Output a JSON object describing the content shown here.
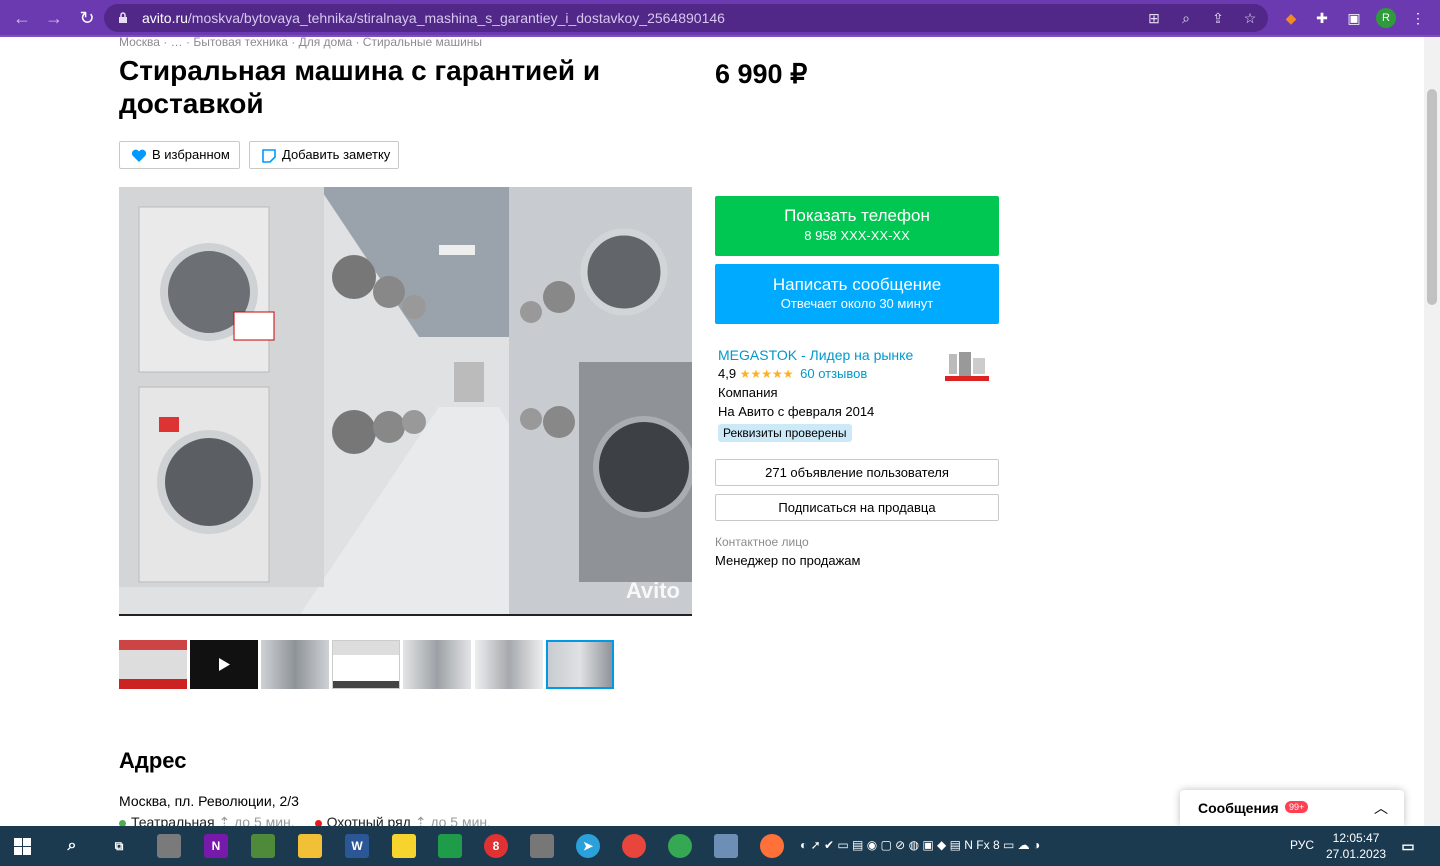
{
  "browser": {
    "url_host": "avito.ru",
    "url_path": "/moskva/bytovaya_tehnika/stiralnaya_mashina_s_garantiey_i_dostavkoy_2564890146",
    "avatar_letter": "R"
  },
  "breadcrumbs": [
    "Москва",
    "…",
    "Бытовая техника",
    "Для дома",
    "Стиральные машины"
  ],
  "listing": {
    "title": "Стиральная машина с гарантией и доставкой",
    "price": "6 990 ₽",
    "favorite_label": "В избранном",
    "note_label": "Добавить заметку",
    "photo_watermark": "Avito",
    "thumbnail_count": 7
  },
  "actions": {
    "phone_title": "Показать телефон",
    "phone_number": "8 958 XXX-XX-XX",
    "message_title": "Написать сообщение",
    "message_sub": "Отвечает около 30 минут"
  },
  "seller": {
    "name": "MEGASTOK - Лидер на рынке",
    "rating": "4,9",
    "stars": "★★★★★",
    "reviews": "60 отзывов",
    "type": "Компания",
    "since": "На Авито с февраля 2014",
    "verified": "Реквизиты проверены",
    "listings_button": "271 объявление пользователя",
    "subscribe_button": "Подписаться на продавца",
    "contact_label": "Контактное лицо",
    "contact_value": "Менеджер по продажам"
  },
  "address": {
    "heading": "Адрес",
    "text": "Москва, пл. Революции, 2/3",
    "metro": [
      {
        "name": "Театральная",
        "time": "до 5 мин.",
        "color": "#4baf4f"
      },
      {
        "name": "Охотный ряд",
        "time": "до 5 мин.",
        "color": "#ef161e"
      }
    ]
  },
  "messages_widget": {
    "label": "Сообщения",
    "count": "99+"
  },
  "taskbar": {
    "language": "РУС",
    "time": "12:05:47",
    "date": "27.01.2023"
  },
  "colors": {
    "chrome": "#6c3ab0",
    "phone_button": "#00c752",
    "message_button": "#00aaff",
    "link": "#0099cc"
  }
}
